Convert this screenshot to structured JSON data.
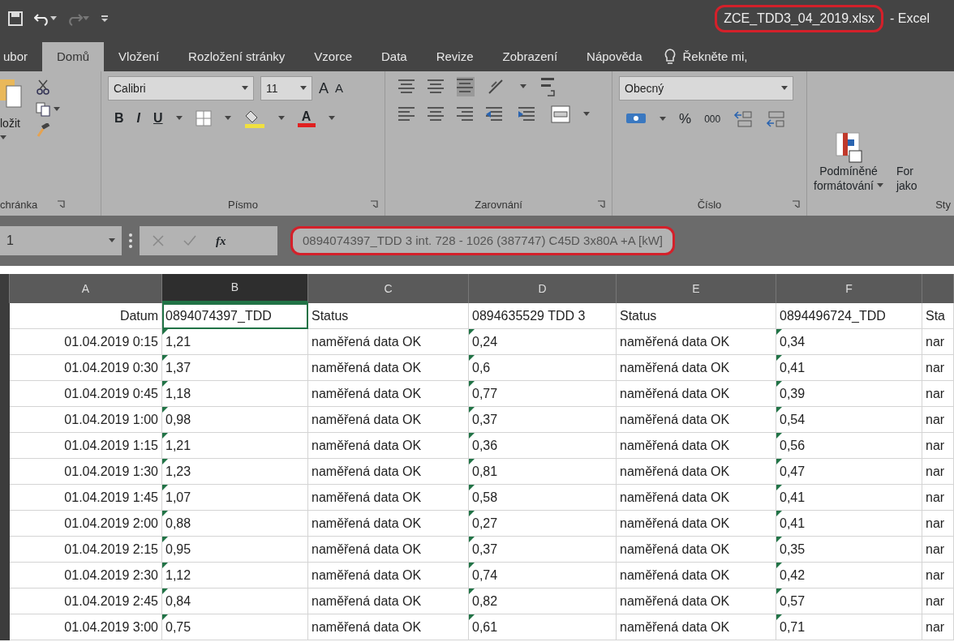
{
  "title_bar": {
    "file_name": "ZCE_TDD3_04_2019.xlsx",
    "file_name_highlighted": true,
    "app": "- Excel"
  },
  "tabs": [
    {
      "label": "ubor",
      "selected": false
    },
    {
      "label": "Domů",
      "selected": true
    },
    {
      "label": "Vložení",
      "selected": false
    },
    {
      "label": "Rozložení stránky",
      "selected": false
    },
    {
      "label": "Vzorce",
      "selected": false
    },
    {
      "label": "Data",
      "selected": false
    },
    {
      "label": "Revize",
      "selected": false
    },
    {
      "label": "Zobrazení",
      "selected": false
    },
    {
      "label": "Nápověda",
      "selected": false
    }
  ],
  "tell_me": "Řekněte mi,",
  "ribbon": {
    "groups": [
      {
        "kind": "clipboard",
        "label": "chránka",
        "paste_label": "ložit"
      },
      {
        "kind": "font",
        "label": "Písmo",
        "font": "Calibri",
        "size": "11",
        "bold": "B",
        "italic": "I",
        "underline": "U",
        "grow": "A",
        "shrink": "A",
        "font_color": "A"
      },
      {
        "kind": "alignment",
        "label": "Zarovnání"
      },
      {
        "kind": "number",
        "label": "Číslo",
        "format": "Obecný",
        "percent": "%",
        "thousands": "000"
      },
      {
        "kind": "styles",
        "label": "Sty",
        "conditional": [
          "Podmíněné",
          "formátování"
        ],
        "format_as": [
          "For",
          "jako"
        ]
      }
    ]
  },
  "formula_bar": {
    "name_box": "1",
    "fx": "fx",
    "formula": "0894074397_TDD 3 int. 728 - 1026 (387747) C45D 3x80A +A [kW]",
    "highlighted": true
  },
  "columns": [
    {
      "letter": "A",
      "selected": false,
      "flagged": false
    },
    {
      "letter": "B",
      "selected": true,
      "flagged": true
    },
    {
      "letter": "C",
      "selected": false,
      "flagged": false
    },
    {
      "letter": "D",
      "selected": false,
      "flagged": true
    },
    {
      "letter": "E",
      "selected": false,
      "flagged": false
    },
    {
      "letter": "F",
      "selected": false,
      "flagged": true
    },
    {
      "selected": false,
      "flagged": false
    }
  ],
  "rows": [
    [
      "Datum",
      "0894074397_TDD",
      "Status",
      "0894635529 TDD 3",
      "Status",
      "0894496724_TDD",
      "Sta"
    ],
    [
      "01.04.2019 0:15",
      "1,21",
      "naměřená data OK",
      "0,24",
      "naměřená data OK",
      "0,34",
      "nar"
    ],
    [
      "01.04.2019 0:30",
      "1,37",
      "naměřená data OK",
      "0,6",
      "naměřená data OK",
      "0,41",
      "nar"
    ],
    [
      "01.04.2019 0:45",
      "1,18",
      "naměřená data OK",
      "0,77",
      "naměřená data OK",
      "0,39",
      "nar"
    ],
    [
      "01.04.2019 1:00",
      "0,98",
      "naměřená data OK",
      "0,37",
      "naměřená data OK",
      "0,54",
      "nar"
    ],
    [
      "01.04.2019 1:15",
      "1,21",
      "naměřená data OK",
      "0,36",
      "naměřená data OK",
      "0,56",
      "nar"
    ],
    [
      "01.04.2019 1:30",
      "1,23",
      "naměřená data OK",
      "0,81",
      "naměřená data OK",
      "0,47",
      "nar"
    ],
    [
      "01.04.2019 1:45",
      "1,07",
      "naměřená data OK",
      "0,58",
      "naměřená data OK",
      "0,41",
      "nar"
    ],
    [
      "01.04.2019 2:00",
      "0,88",
      "naměřená data OK",
      "0,27",
      "naměřená data OK",
      "0,41",
      "nar"
    ],
    [
      "01.04.2019 2:15",
      "0,95",
      "naměřená data OK",
      "0,37",
      "naměřená data OK",
      "0,35",
      "nar"
    ],
    [
      "01.04.2019 2:30",
      "1,12",
      "naměřená data OK",
      "0,74",
      "naměřená data OK",
      "0,42",
      "nar"
    ],
    [
      "01.04.2019 2:45",
      "0,84",
      "naměřená data OK",
      "0,82",
      "naměřená data OK",
      "0,57",
      "nar"
    ],
    [
      "01.04.2019 3:00",
      "0,75",
      "naměřená data OK",
      "0,61",
      "naměřená data OK",
      "0,71",
      "nar"
    ]
  ]
}
